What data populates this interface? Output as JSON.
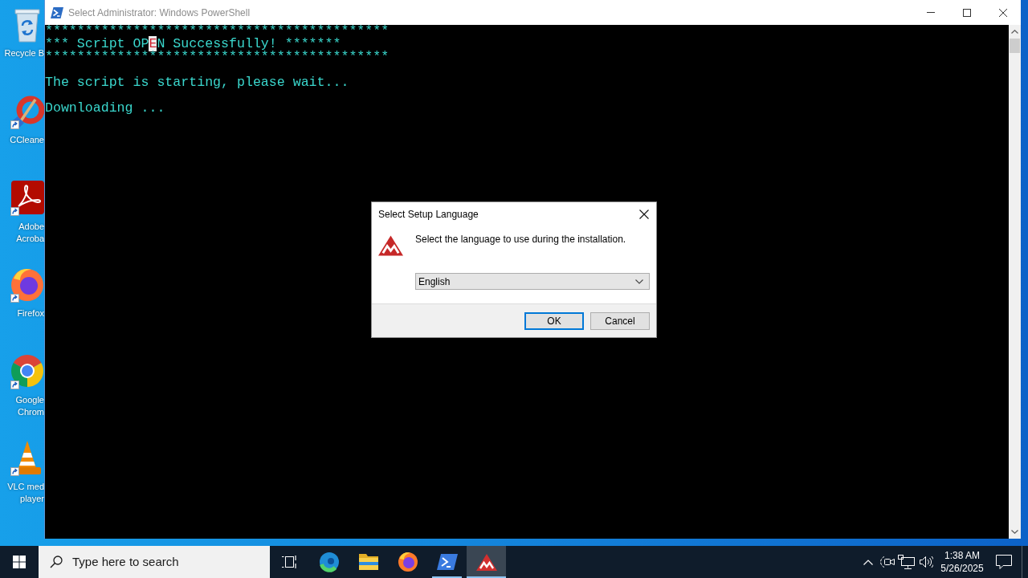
{
  "desktop": {
    "icons": [
      {
        "kind": "recyclebin",
        "label": [
          "Recycle B"
        ],
        "shortcut": false
      },
      {
        "kind": "ccleaner",
        "label": [
          "CCleane"
        ],
        "shortcut": true
      },
      {
        "kind": "acrobat",
        "label": [
          "Adobe",
          "Acroba"
        ],
        "shortcut": true
      },
      {
        "kind": "firefox",
        "label": [
          "Firefox"
        ],
        "shortcut": true
      },
      {
        "kind": "chrome",
        "label": [
          "Google",
          "Chrom"
        ],
        "shortcut": true
      },
      {
        "kind": "vlc",
        "label": [
          "VLC med",
          "player"
        ],
        "shortcut": true
      }
    ]
  },
  "console_window": {
    "title": "Select Administrator: Windows PowerShell",
    "lines": [
      {
        "kind": "text",
        "segments": [
          {
            "text": "*******************************************",
            "selected": false
          }
        ]
      },
      {
        "kind": "text",
        "segments": [
          {
            "text": "*** Script OP",
            "selected": false
          },
          {
            "text": "E",
            "selected": true
          },
          {
            "text": "N Successfully! *******",
            "selected": false
          }
        ]
      },
      {
        "kind": "text",
        "segments": [
          {
            "text": "*******************************************",
            "selected": false
          }
        ]
      },
      {
        "kind": "blank"
      },
      {
        "kind": "text",
        "segments": [
          {
            "text": "The script is starting, please wait...",
            "selected": false
          }
        ]
      },
      {
        "kind": "blank"
      },
      {
        "kind": "text",
        "segments": [
          {
            "text": "Downloading ...",
            "selected": false
          }
        ]
      }
    ]
  },
  "dialog": {
    "title": "Select Setup Language",
    "message": "Select the language to use during the installation.",
    "language": {
      "value": "English"
    },
    "buttons": [
      {
        "label": "OK",
        "default": true
      },
      {
        "label": "Cancel",
        "default": false
      }
    ]
  },
  "taskbar": {
    "search": {
      "placeholder": "Type here to search"
    },
    "apps": [
      {
        "kind": "edge",
        "running": false,
        "active": false
      },
      {
        "kind": "explorer",
        "running": false,
        "active": false
      },
      {
        "kind": "firefox",
        "running": false,
        "active": false
      },
      {
        "kind": "powershell",
        "running": true,
        "active": false
      },
      {
        "kind": "installer",
        "running": true,
        "active": true
      }
    ],
    "clock": {
      "time": "1:38 AM",
      "date": "5/26/2025"
    }
  }
}
